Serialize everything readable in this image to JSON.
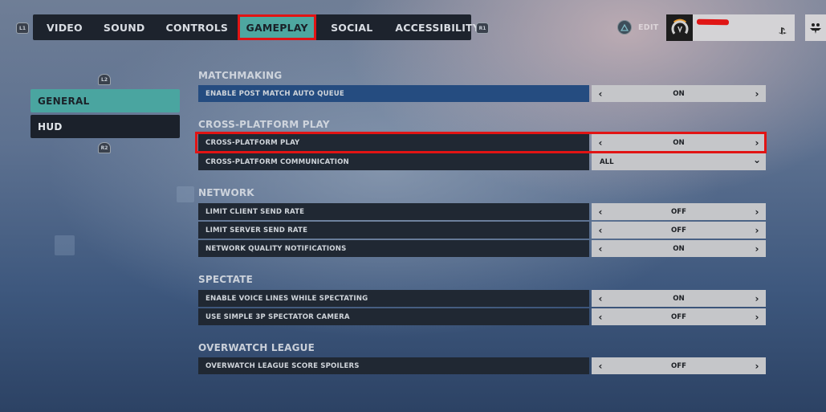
{
  "top_nav": {
    "left_bumper": "L1",
    "right_bumper": "R1",
    "tabs": [
      {
        "label": "VIDEO",
        "active": false
      },
      {
        "label": "SOUND",
        "active": false
      },
      {
        "label": "CONTROLS",
        "active": false
      },
      {
        "label": "GAMEPLAY",
        "active": true
      },
      {
        "label": "SOCIAL",
        "active": false
      },
      {
        "label": "ACCESSIBILITY",
        "active": false
      }
    ]
  },
  "profile": {
    "edit_button_icon": "triangle-icon",
    "edit_label": "EDIT",
    "logo_icon": "overwatch-logo-icon",
    "name_redacted": true,
    "platform_icon": "playstation-icon",
    "social_icon": "social-group-icon"
  },
  "side_nav": {
    "up_trigger": "L2",
    "down_trigger": "R2",
    "items": [
      {
        "label": "GENERAL",
        "active": true
      },
      {
        "label": "HUD",
        "active": false
      }
    ]
  },
  "sections": [
    {
      "title": "MATCHMAKING",
      "rows": [
        {
          "label": "ENABLE POST MATCH AUTO QUEUE",
          "value": "ON",
          "type": "toggle",
          "focused": true
        }
      ]
    },
    {
      "title": "CROSS-PLATFORM PLAY",
      "rows": [
        {
          "label": "CROSS-PLATFORM PLAY",
          "value": "ON",
          "type": "toggle",
          "annotated": true
        },
        {
          "label": "CROSS-PLATFORM COMMUNICATION",
          "value": "ALL",
          "type": "dropdown"
        }
      ]
    },
    {
      "title": "NETWORK",
      "rows": [
        {
          "label": "LIMIT CLIENT SEND RATE",
          "value": "OFF",
          "type": "toggle"
        },
        {
          "label": "LIMIT SERVER SEND RATE",
          "value": "OFF",
          "type": "toggle"
        },
        {
          "label": "NETWORK QUALITY NOTIFICATIONS",
          "value": "ON",
          "type": "toggle"
        }
      ]
    },
    {
      "title": "SPECTATE",
      "rows": [
        {
          "label": "ENABLE VOICE LINES WHILE SPECTATING",
          "value": "ON",
          "type": "toggle"
        },
        {
          "label": "USE SIMPLE 3P SPECTATOR CAMERA",
          "value": "OFF",
          "type": "toggle"
        }
      ]
    },
    {
      "title": "OVERWATCH LEAGUE",
      "rows": [
        {
          "label": "OVERWATCH LEAGUE SCORE SPOILERS",
          "value": "OFF",
          "type": "toggle"
        }
      ]
    }
  ],
  "glyphs": {
    "arrow_left": "‹",
    "arrow_right": "›",
    "chevron_down": "⌄",
    "playstation": "⏏"
  },
  "colors": {
    "accent_teal": "#4ea7a0",
    "annotation_red": "#e11414",
    "focus_blue": "#254c80"
  }
}
